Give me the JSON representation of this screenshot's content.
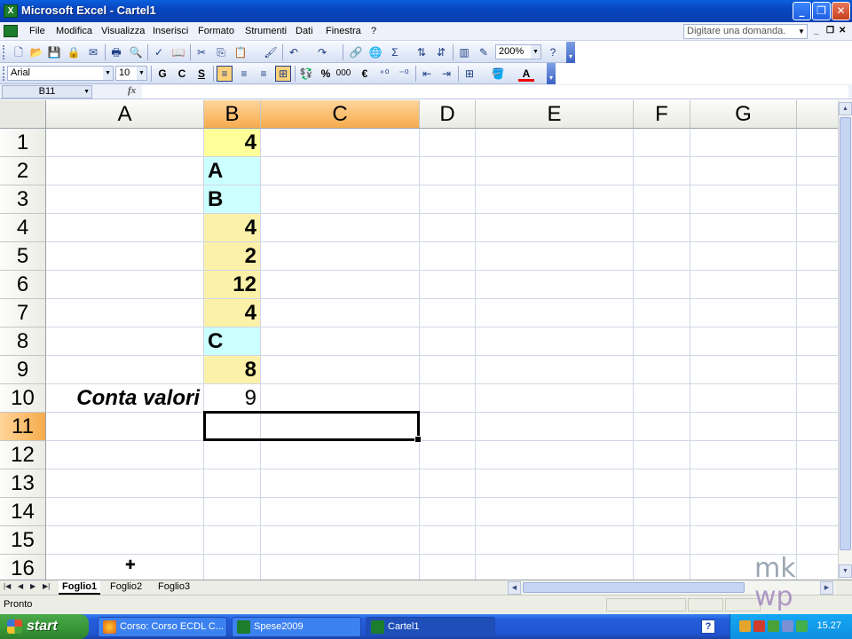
{
  "window": {
    "title": "Microsoft Excel - Cartel1",
    "minimize": "_",
    "restore": "❐",
    "close": "✕"
  },
  "menu": {
    "items": [
      "File",
      "Modifica",
      "Visualizza",
      "Inserisci",
      "Formato",
      "Strumenti",
      "Dati",
      "Finestra",
      "?"
    ],
    "ask_placeholder": "Digitare una domanda.",
    "doc_min": "_",
    "doc_restore": "❐",
    "doc_close": "✕"
  },
  "toolbar": {
    "zoom": "200%",
    "font_name": "Arial",
    "font_size": "10",
    "bold": "G",
    "italic": "C",
    "underline": "S",
    "percent": "%",
    "thousands": "000",
    "euro": "€",
    "sigma": "Σ"
  },
  "formula_bar": {
    "name_box": "B11",
    "fx": "fx",
    "content": ""
  },
  "grid": {
    "columns": [
      "A",
      "B",
      "C",
      "D",
      "E",
      "F",
      "G"
    ],
    "rows": [
      "1",
      "2",
      "3",
      "4",
      "5",
      "6",
      "7",
      "8",
      "9",
      "10",
      "11",
      "12",
      "13",
      "14",
      "15",
      "16"
    ],
    "selected_cell": "B11",
    "cells": {
      "B1": "4",
      "B2": "A",
      "B3": "B",
      "B4": "4",
      "B5": "2",
      "B6": "12",
      "B7": "4",
      "B8": "C",
      "B9": "8",
      "A10": "Conta valori",
      "B10": "9"
    }
  },
  "sheets": {
    "tabs": [
      "Foglio1",
      "Foglio2",
      "Foglio3"
    ],
    "active": "Foglio1"
  },
  "status": {
    "text": "Pronto"
  },
  "taskbar": {
    "start": "start",
    "items": [
      "Corso: Corso ECDL C...",
      "Spese2009",
      "Cartel1"
    ],
    "clock": "15.27",
    "help": "?"
  },
  "colors": {
    "accent": "#f6ab4c",
    "number_fill": "#ffff99",
    "text_fill": "#ccffff",
    "xp_blue": "#245edb"
  }
}
